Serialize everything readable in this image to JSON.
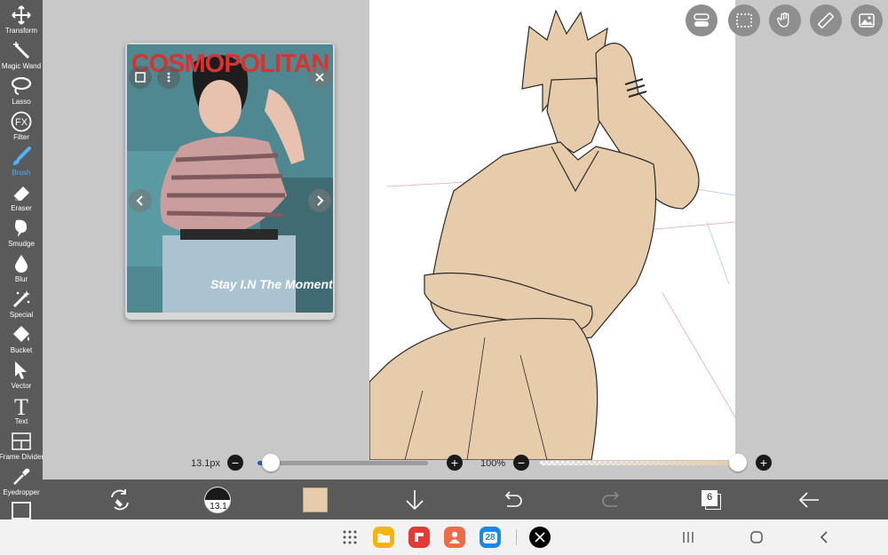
{
  "toolbar": {
    "tools": [
      {
        "label": "Transform",
        "icon": "transform-icon"
      },
      {
        "label": "Magic Wand",
        "icon": "magic-wand-icon"
      },
      {
        "label": "Lasso",
        "icon": "lasso-icon"
      },
      {
        "label": "Filter",
        "icon": "fx-icon"
      },
      {
        "label": "Brush",
        "icon": "brush-icon",
        "active": true
      },
      {
        "label": "Eraser",
        "icon": "eraser-icon"
      },
      {
        "label": "Smudge",
        "icon": "smudge-icon"
      },
      {
        "label": "Blur",
        "icon": "blur-icon"
      },
      {
        "label": "Special",
        "icon": "special-icon"
      },
      {
        "label": "Bucket",
        "icon": "bucket-icon"
      },
      {
        "label": "Vector",
        "icon": "vector-icon"
      },
      {
        "label": "Text",
        "icon": "text-icon"
      },
      {
        "label": "Frame Divider",
        "icon": "frame-divider-icon"
      },
      {
        "label": "Eyedropper",
        "icon": "eyedropper-icon"
      },
      {
        "label": "",
        "icon": "canvas-icon"
      }
    ]
  },
  "reference": {
    "magazine_title": "COSMOPOLITAN",
    "caption": "Stay I.N The Moment"
  },
  "sliders": {
    "brush_size": "13.1px",
    "opacity": "100%",
    "brush_size_value": 0.08,
    "opacity_value": 1.0
  },
  "actionbar": {
    "brush_preview_label": "13.1",
    "layers_count": "6"
  },
  "colors": {
    "toolbar_bg": "#5a5a5a",
    "accent_active": "#4fb3ff",
    "current_color": "#e6ccaa",
    "workspace_bg": "#c8c8c8"
  },
  "sysbar": {
    "calendar_day": "28",
    "apps": [
      "app-drawer-icon",
      "files-icon",
      "flipboard-icon",
      "contacts-icon",
      "calendar-icon",
      "x-icon"
    ]
  }
}
